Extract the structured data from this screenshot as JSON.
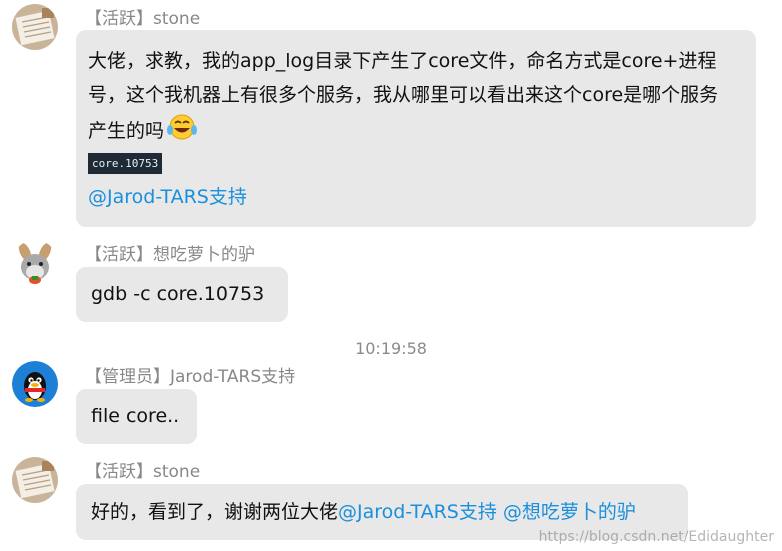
{
  "messages": [
    {
      "avatar": "notebook-avatar",
      "sender": "【活跃】stone",
      "lines": [
        "大佬，求教，我的app_log目录下产生了core文件，命名方式是core+进程",
        "号，这个我机器上有很多个服务，我从哪里可以看出来这个core是哪个服务",
        "产生的吗"
      ],
      "emoji": "laugh-cry-emoji",
      "code": "core.10753",
      "mention": "@Jarod-TARS支持"
    },
    {
      "avatar": "donkey-avatar",
      "sender": "【活跃】想吃萝卜的驴",
      "text": "gdb -c core.10753"
    },
    {
      "avatar": "qq-penguin-avatar",
      "sender": "【管理员】Jarod-TARS支持",
      "text": "file core.."
    },
    {
      "avatar": "notebook-avatar",
      "sender": "【活跃】stone",
      "text": "好的，看到了，谢谢两位大佬",
      "mentions": "@Jarod-TARS支持 @想吃萝卜的驴"
    }
  ],
  "timestamp": "10:19:58",
  "watermark": "https://blog.csdn.net/Edidaughter",
  "colors": {
    "bubble": "#e8e8e8",
    "mention": "#1a8fdd",
    "sender": "#888888",
    "code_bg": "#1e2a36"
  }
}
